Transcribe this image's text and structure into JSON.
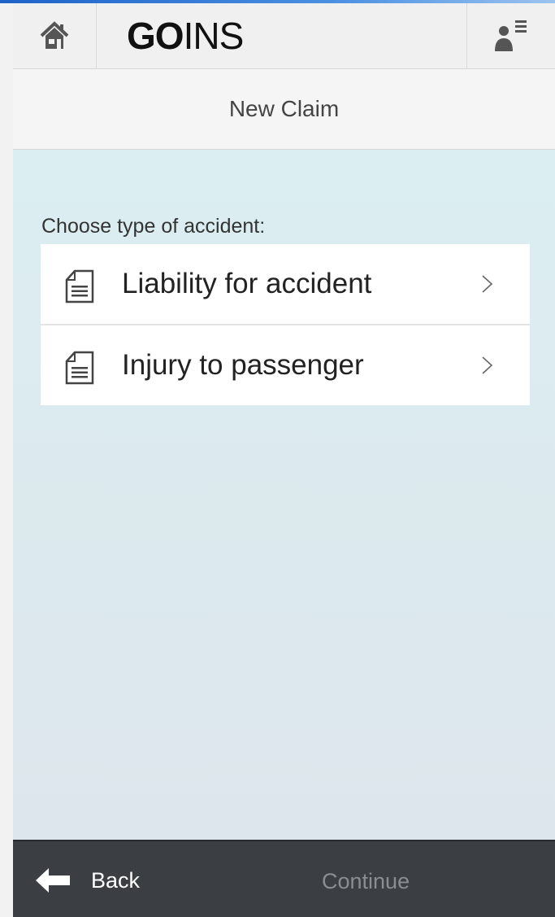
{
  "header": {
    "home_icon": "home-icon",
    "logo_bold": "GO",
    "logo_light": "INS",
    "user_icon": "user-menu-icon"
  },
  "page": {
    "title": "New Claim",
    "prompt": "Choose type of accident:"
  },
  "options": [
    {
      "label": "Liability for accident",
      "icon": "document-icon"
    },
    {
      "label": "Injury to passenger",
      "icon": "document-icon"
    }
  ],
  "footer": {
    "back_label": "Back",
    "continue_label": "Continue"
  },
  "colors": {
    "accent_line": "#1d63c8",
    "footer_bg": "#3b3f43",
    "content_bg": "#dbeef1",
    "disabled_text": "#8a8e92"
  }
}
